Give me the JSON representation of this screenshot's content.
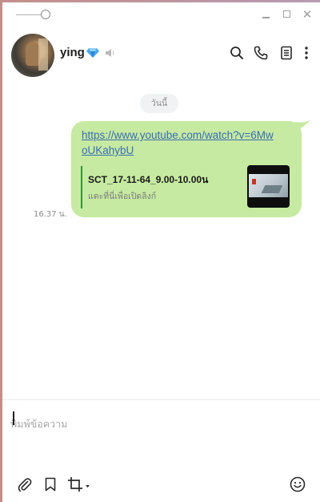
{
  "window": {
    "controls": [
      "minimize",
      "maximize",
      "close"
    ],
    "close_glyph": "✕"
  },
  "header": {
    "contact_name": "ying",
    "icons": [
      "diamond-icon",
      "mute-icon",
      "search-icon",
      "phone-icon",
      "notes-icon",
      "more-icon"
    ]
  },
  "chat": {
    "date_label": "วันนี้",
    "message": {
      "link": "https://www.youtube.com/watch?v=6MwoUKahybU",
      "preview_title": "SCT_17-11-64_9.00-10.00น",
      "preview_subtitle": "แตะที่นี่เพื่อเปิดลิงก์",
      "time": "16.37 น.",
      "bubble_color": "#c6eaa1",
      "link_color": "#3b6db4"
    }
  },
  "composer": {
    "placeholder": "พิมพ์ข้อความ",
    "tools": [
      "attach-icon",
      "bookmark-icon",
      "crop-icon",
      "emoji-icon"
    ]
  }
}
